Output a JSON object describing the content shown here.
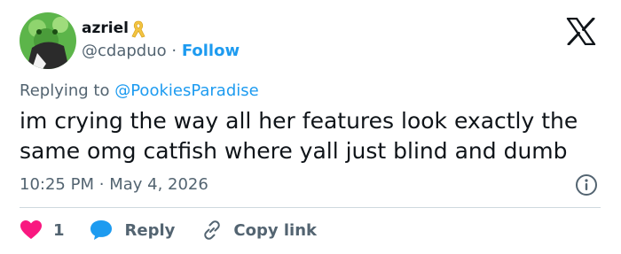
{
  "author": {
    "display_name": "azriel",
    "handle": "@cdapduo",
    "separator": "·",
    "follow_label": "Follow"
  },
  "reply_context": {
    "prefix": "Replying to",
    "mention": "@PookiesParadise"
  },
  "tweet": {
    "text": "im crying the way all her features look exactly the same omg catfish where yall just blind and dumb"
  },
  "meta": {
    "time": "10:25 PM",
    "separator": "·",
    "date": "May 4, 2026"
  },
  "actions": {
    "like_count": "1",
    "reply_label": "Reply",
    "copy_link_label": "Copy link"
  },
  "colors": {
    "link_blue": "#1d9bf0",
    "muted_text": "#536471",
    "heart_pink": "#f91880",
    "ribbon_gold": "#f4c542",
    "divider": "#cfd9de"
  },
  "icons": {
    "brand": "x-logo-icon",
    "badge": "awareness-ribbon-icon",
    "info": "info-icon",
    "like": "heart-icon",
    "reply": "speech-bubble-icon",
    "copy": "link-icon"
  }
}
